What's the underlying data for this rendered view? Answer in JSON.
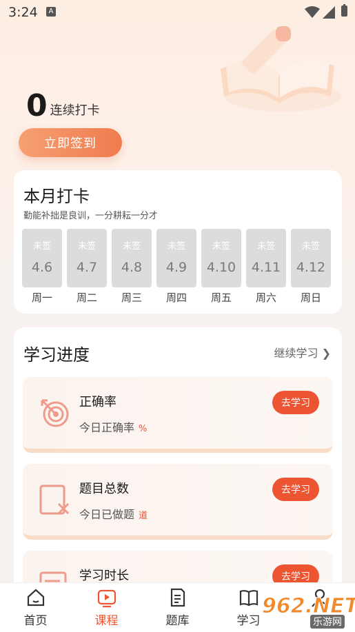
{
  "status_bar": {
    "time": "3:24",
    "notification_icon": "A"
  },
  "streak": {
    "count": "0",
    "label": "连续打卡"
  },
  "checkin_button": "立即签到",
  "month": {
    "title": "本月打卡",
    "subtitle": "勤能补拙是良训，一分耕耘一分才",
    "days": [
      {
        "status": "未签",
        "date": "4.6",
        "weekday": "周一"
      },
      {
        "status": "未签",
        "date": "4.7",
        "weekday": "周二"
      },
      {
        "status": "未签",
        "date": "4.8",
        "weekday": "周三"
      },
      {
        "status": "未签",
        "date": "4.9",
        "weekday": "周四"
      },
      {
        "status": "未签",
        "date": "4.10",
        "weekday": "周五"
      },
      {
        "status": "未签",
        "date": "4.11",
        "weekday": "周六"
      },
      {
        "status": "未签",
        "date": "4.12",
        "weekday": "周日"
      }
    ]
  },
  "progress": {
    "title": "学习进度",
    "continue_label": "继续学习 ❯",
    "items": [
      {
        "title": "正确率",
        "subtitle": "今日正确率",
        "unit": "%",
        "button": "去学习",
        "icon": "target-icon"
      },
      {
        "title": "题目总数",
        "subtitle": "今日已做题",
        "unit": "道",
        "button": "去学习",
        "icon": "question-cross-icon"
      },
      {
        "title": "学习时长",
        "subtitle": "",
        "unit": "",
        "button": "去学习",
        "icon": "document-icon"
      }
    ]
  },
  "nav": {
    "items": [
      {
        "label": "首页",
        "icon": "home-icon"
      },
      {
        "label": "课程",
        "icon": "play-icon"
      },
      {
        "label": "题库",
        "icon": "question-bank-icon"
      },
      {
        "label": "学习",
        "icon": "book-icon"
      },
      {
        "label": "",
        "icon": "user-icon"
      }
    ],
    "active_color": "#ed5431"
  },
  "watermark": {
    "text": "962.NET",
    "sub": "乐游网"
  },
  "colors": {
    "accent": "#ed5431",
    "button_gradient_start": "#f6a072",
    "button_gradient_end": "#ef7b4e"
  }
}
